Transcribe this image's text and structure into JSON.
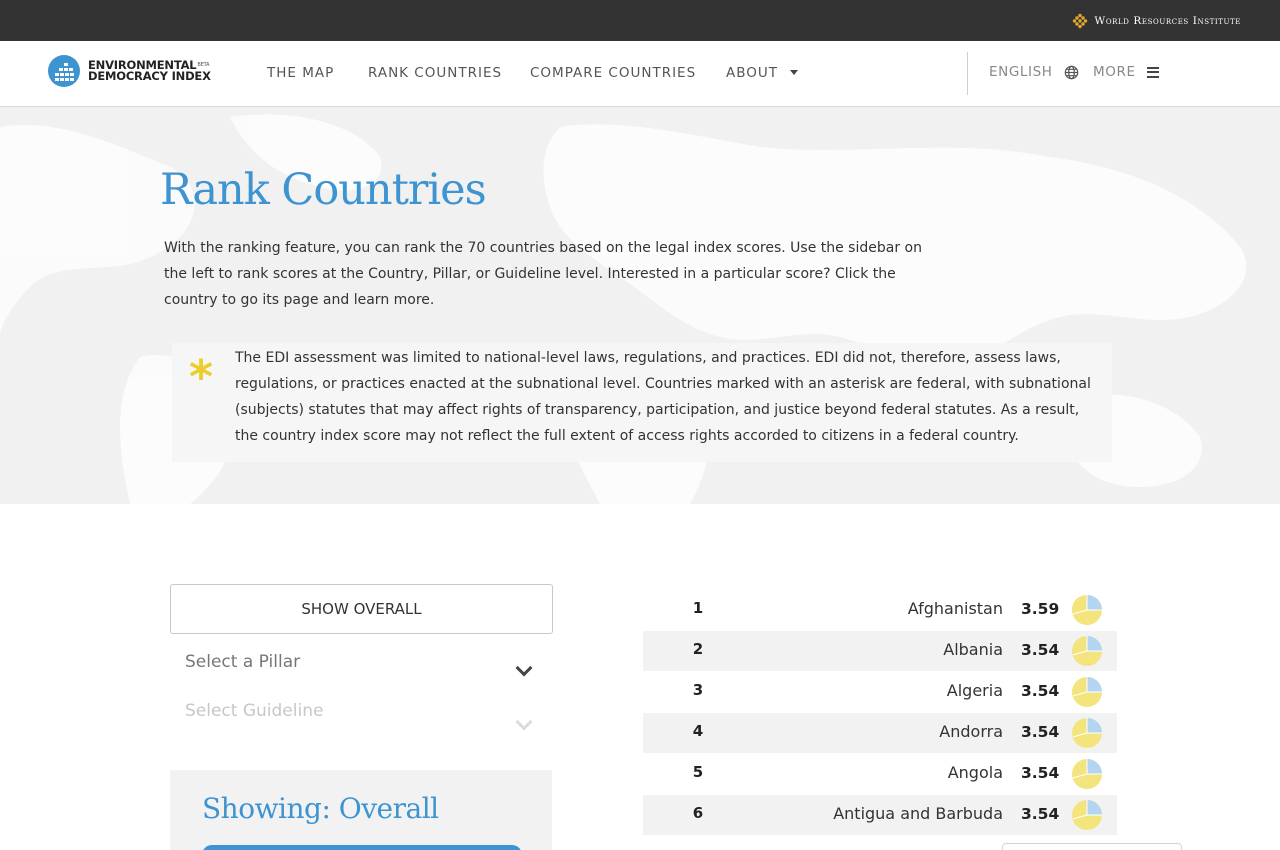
{
  "topbar": {
    "wri_label": "World Resources Institute"
  },
  "header": {
    "logo_line1": "ENVIRONMENTAL",
    "logo_beta": "BETA",
    "logo_line2": "DEMOCRACY INDEX",
    "nav": [
      {
        "label": "THE MAP"
      },
      {
        "label": "RANK COUNTRIES"
      },
      {
        "label": "COMPARE COUNTRIES"
      },
      {
        "label": "ABOUT"
      }
    ],
    "language": "ENGLISH",
    "more": "MORE"
  },
  "hero": {
    "title": "Rank Countries",
    "intro": "With the ranking feature, you can rank the 70 countries based on the legal index scores. Use the sidebar on the left to rank scores at the Country, Pillar, or Guideline level. Interested in a particular score? Click the country to go its page and learn more.",
    "note_symbol": "*",
    "note": "The EDI assessment was limited to national-level laws, regulations, and practices. EDI did not, therefore, assess laws, regulations, or practices enacted at the subnational level. Countries marked with an asterisk are federal, with subnational (subjects) statutes that may affect rights of transparency, participation, and justice beyond federal statutes. As a result, the country index score may not reflect the full extent of access rights accorded to citizens in a federal country."
  },
  "sidebar": {
    "show_overall": "SHOW OVERALL",
    "pillar_select": "Select a Pillar",
    "guideline_select": "Select  Guideline",
    "showing_title": "Showing: Overall"
  },
  "ranking": {
    "rows": [
      {
        "rank": "1",
        "country": "Afghanistan",
        "score": "3.59"
      },
      {
        "rank": "2",
        "country": "Albania",
        "score": "3.54"
      },
      {
        "rank": "3",
        "country": "Algeria",
        "score": "3.54"
      },
      {
        "rank": "4",
        "country": "Andorra",
        "score": "3.54"
      },
      {
        "rank": "5",
        "country": "Angola",
        "score": "3.54"
      },
      {
        "rank": "6",
        "country": "Antigua and Barbuda",
        "score": "3.54"
      }
    ]
  },
  "colors": {
    "accent_blue": "#3d94d1",
    "asterisk_yellow": "#eccd2c",
    "pie_yellow": "#f3e47e",
    "pie_blue": "#b3d5f1",
    "topbar": "#333333"
  }
}
